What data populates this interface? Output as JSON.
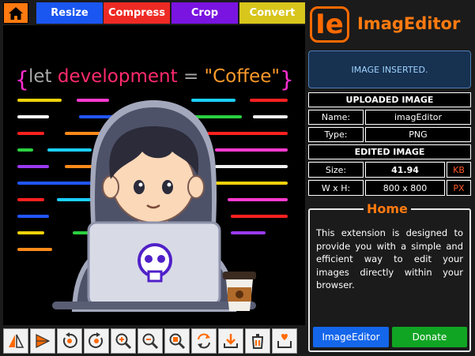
{
  "nav": {
    "home_icon": "home-icon",
    "buttons": [
      {
        "label": "Resize",
        "color": "#1a56f0"
      },
      {
        "label": "Compress",
        "color": "#ee2a24"
      },
      {
        "label": "Crop",
        "color": "#7a14e0"
      },
      {
        "label": "Convert",
        "color": "#d8c61c"
      }
    ]
  },
  "preview": {
    "code": {
      "kw": "let",
      "name": "development",
      "op": "=",
      "value": "\"Coffee\"",
      "open": "{",
      "close": "}"
    }
  },
  "tools": [
    "flip-horizontal-icon",
    "flip-vertical-icon",
    "rotate-left-icon",
    "rotate-right-icon",
    "zoom-in-icon",
    "zoom-out-icon",
    "zoom-reset-icon",
    "reset-icon",
    "download-icon",
    "delete-icon",
    "save-icon"
  ],
  "brand": {
    "logo": "Ie",
    "name": "ImagEditor",
    "color": "#ff7a10"
  },
  "status": "IMAGE INSERTED.",
  "uploaded": {
    "header": "UPLOADED IMAGE",
    "name_label": "Name:",
    "name_value": "imagEditor",
    "type_label": "Type:",
    "type_value": "PNG"
  },
  "edited": {
    "header": "EDITED IMAGE",
    "size_label": "Size:",
    "size_value": "41.94",
    "size_unit": "KB",
    "dim_label": "W x H:",
    "dim_value": "800 x 800",
    "dim_unit": "PX"
  },
  "home": {
    "title": "Home",
    "description": "This extension is designed to provide you with a simple and efficient way to edit your images directly within your browser.",
    "btn_editor": "ImageEditor",
    "btn_donate": "Donate"
  }
}
